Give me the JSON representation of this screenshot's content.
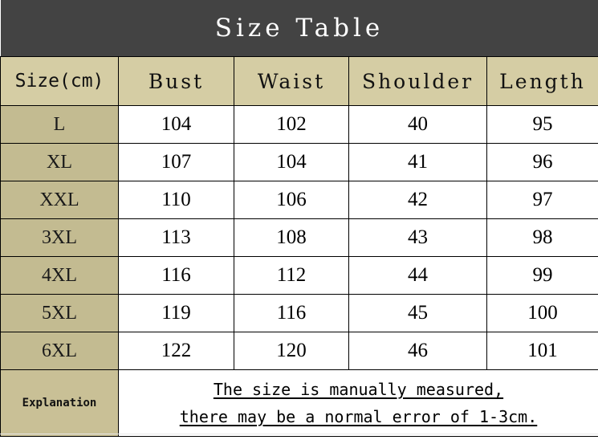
{
  "title": "Size Table",
  "colors": {
    "title_bar": "#434343",
    "header_cell": "#d5cda4",
    "size_cell": "#c3bb91",
    "explain_label_cell": "#c9c096",
    "body_cell": "#ffffff",
    "border": "#000000",
    "title_text": "#ffffff",
    "body_text": "#000000"
  },
  "columns": [
    "Size(cm)",
    "Bust",
    "Waist",
    "Shoulder",
    "Length"
  ],
  "rows": [
    {
      "size": "L",
      "bust": "104",
      "waist": "102",
      "shoulder": "40",
      "length": "95"
    },
    {
      "size": "XL",
      "bust": "107",
      "waist": "104",
      "shoulder": "41",
      "length": "96"
    },
    {
      "size": "XXL",
      "bust": "110",
      "waist": "106",
      "shoulder": "42",
      "length": "97"
    },
    {
      "size": "3XL",
      "bust": "113",
      "waist": "108",
      "shoulder": "43",
      "length": "98"
    },
    {
      "size": "4XL",
      "bust": "116",
      "waist": "112",
      "shoulder": "44",
      "length": "99"
    },
    {
      "size": "5XL",
      "bust": "119",
      "waist": "116",
      "shoulder": "45",
      "length": "100"
    },
    {
      "size": "6XL",
      "bust": "122",
      "waist": "120",
      "shoulder": "46",
      "length": "101"
    }
  ],
  "explanation": {
    "label": "Explanation",
    "line1": "The size is manually measured,",
    "line2": "there may be a normal error of 1-3cm."
  }
}
